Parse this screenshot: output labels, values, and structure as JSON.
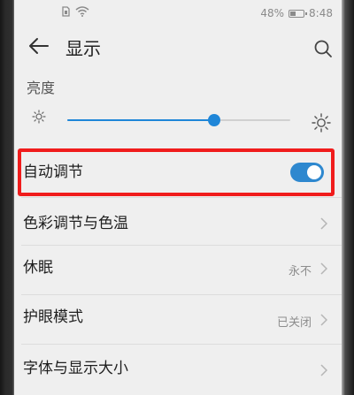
{
  "status_bar": {
    "battery_percent": "48%",
    "battery_level": 0.48,
    "time": "8:48",
    "icons": [
      "sim-icon",
      "wifi-icon",
      "battery-icon"
    ]
  },
  "header": {
    "title": "显示",
    "back_icon": "back-arrow-icon",
    "search_icon": "search-icon"
  },
  "brightness": {
    "label": "亮度",
    "level": 0.66,
    "min_icon": "sun-small-icon",
    "max_icon": "sun-large-icon"
  },
  "settings": {
    "auto_adjust": {
      "label": "自动调节",
      "enabled": true
    },
    "color_temp": {
      "label": "色彩调节与色温",
      "value": ""
    },
    "sleep": {
      "label": "休眠",
      "value": "永不"
    },
    "eye_comfort": {
      "label": "护眼模式",
      "value": "已关闭"
    },
    "font_size": {
      "label": "字体与显示大小",
      "value": ""
    }
  },
  "colors": {
    "accent": "#1f86d8",
    "highlight": "#f01c1c"
  }
}
